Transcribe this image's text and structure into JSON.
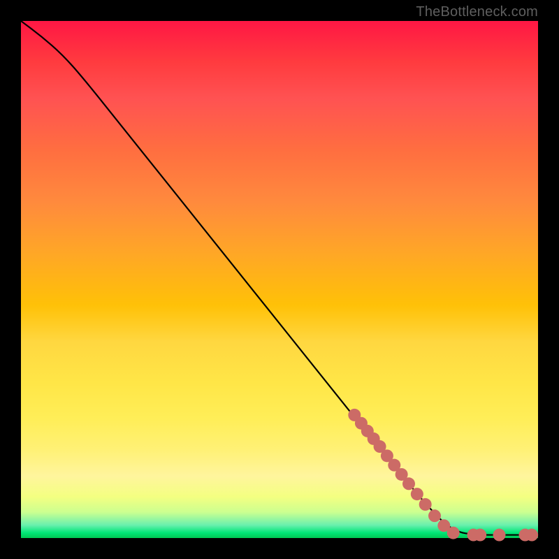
{
  "attribution": "TheBottleneck.com",
  "colors": {
    "dot_fill": "#cc6b66",
    "curve_stroke": "#000000",
    "background": "#000000"
  },
  "chart_data": {
    "type": "line",
    "title": "",
    "xlabel": "",
    "ylabel": "",
    "xlim": [
      0,
      100
    ],
    "ylim": [
      0,
      100
    ],
    "grid": false,
    "legend": false,
    "curve": [
      {
        "x": 0,
        "y": 100
      },
      {
        "x": 4,
        "y": 97
      },
      {
        "x": 8,
        "y": 93.5
      },
      {
        "x": 12,
        "y": 89
      },
      {
        "x": 20,
        "y": 79
      },
      {
        "x": 30,
        "y": 66.5
      },
      {
        "x": 40,
        "y": 54
      },
      {
        "x": 50,
        "y": 41.5
      },
      {
        "x": 60,
        "y": 29
      },
      {
        "x": 70,
        "y": 16.5
      },
      {
        "x": 80,
        "y": 4.5
      },
      {
        "x": 84,
        "y": 1.2
      },
      {
        "x": 88,
        "y": 0.6
      },
      {
        "x": 94,
        "y": 0.6
      },
      {
        "x": 100,
        "y": 0.6
      }
    ],
    "dots": [
      {
        "x": 64.5,
        "y": 23.8
      },
      {
        "x": 65.8,
        "y": 22.2
      },
      {
        "x": 67.0,
        "y": 20.7
      },
      {
        "x": 68.2,
        "y": 19.2
      },
      {
        "x": 69.4,
        "y": 17.7
      },
      {
        "x": 70.8,
        "y": 15.9
      },
      {
        "x": 72.2,
        "y": 14.1
      },
      {
        "x": 73.6,
        "y": 12.3
      },
      {
        "x": 75.0,
        "y": 10.5
      },
      {
        "x": 76.6,
        "y": 8.5
      },
      {
        "x": 78.2,
        "y": 6.5
      },
      {
        "x": 80.0,
        "y": 4.3
      },
      {
        "x": 81.8,
        "y": 2.4
      },
      {
        "x": 83.6,
        "y": 1.0
      },
      {
        "x": 87.5,
        "y": 0.6
      },
      {
        "x": 88.8,
        "y": 0.6
      },
      {
        "x": 92.5,
        "y": 0.6
      },
      {
        "x": 97.5,
        "y": 0.6
      },
      {
        "x": 98.8,
        "y": 0.6
      }
    ]
  }
}
